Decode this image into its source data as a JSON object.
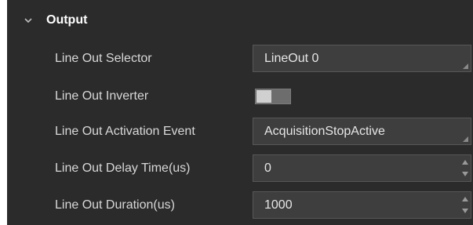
{
  "section": {
    "title": "Output",
    "expanded": true,
    "chevron_icon": "chevron-down-icon"
  },
  "rows": [
    {
      "label": "Line Out Selector",
      "control": "dropdown",
      "value": "LineOut 0"
    },
    {
      "label": "Line Out Inverter",
      "control": "toggle",
      "value": false
    },
    {
      "label": "Line Out Activation Event",
      "control": "dropdown",
      "value": "AcquisitionStopActive"
    },
    {
      "label": "Line Out Delay Time(us)",
      "control": "spinbox",
      "value": "0"
    },
    {
      "label": "Line Out Duration(us)",
      "control": "spinbox",
      "value": "1000"
    }
  ],
  "colors": {
    "panel_bg": "#2b2b2b",
    "field_bg": "#3e3e3e",
    "field_border": "#575757",
    "label_text": "#d8d8d8",
    "value_text": "#e6e6e6"
  }
}
